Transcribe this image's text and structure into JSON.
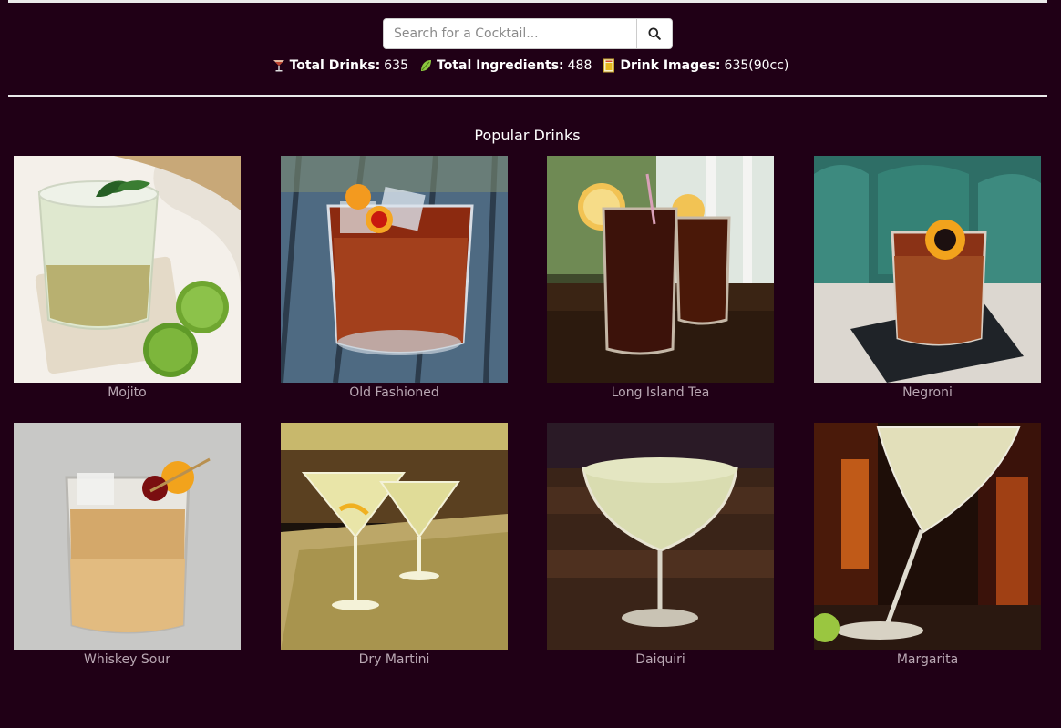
{
  "search": {
    "placeholder": "Search for a Cocktail..."
  },
  "stats": {
    "total_drinks_label": "Total Drinks:",
    "total_drinks_value": "635",
    "total_ingredients_label": "Total Ingredients:",
    "total_ingredients_value": "488",
    "drink_images_label": "Drink Images:",
    "drink_images_value": "635(90cc)"
  },
  "section": {
    "title": "Popular Drinks"
  },
  "drinks": [
    {
      "name": "Mojito"
    },
    {
      "name": "Old Fashioned"
    },
    {
      "name": "Long Island Tea"
    },
    {
      "name": "Negroni"
    },
    {
      "name": "Whiskey Sour"
    },
    {
      "name": "Dry Martini"
    },
    {
      "name": "Daiquiri"
    },
    {
      "name": "Margarita"
    }
  ],
  "colors": {
    "background": "#200016",
    "rule": "#e9e9e9",
    "drink_name": "#b9a7b3"
  }
}
